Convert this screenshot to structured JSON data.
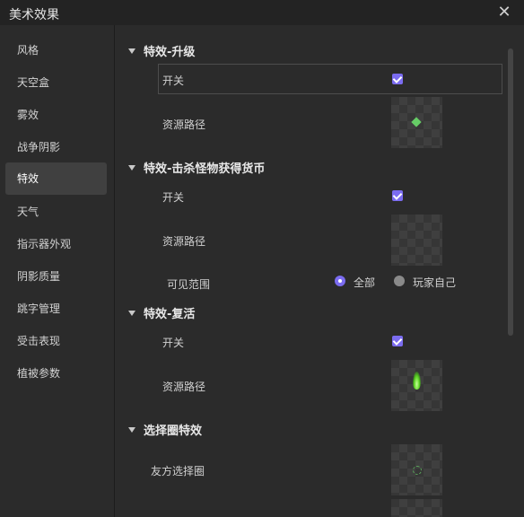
{
  "window": {
    "title": "美术效果",
    "close_icon": "close-icon"
  },
  "sidebar": {
    "items": [
      {
        "label": "风格"
      },
      {
        "label": "天空盒"
      },
      {
        "label": "雾效"
      },
      {
        "label": "战争阴影"
      },
      {
        "label": "特效",
        "active": true
      },
      {
        "label": "天气"
      },
      {
        "label": "指示器外观"
      },
      {
        "label": "阴影质量"
      },
      {
        "label": "跳字管理"
      },
      {
        "label": "受击表现"
      },
      {
        "label": "植被参数"
      }
    ]
  },
  "sections": [
    {
      "title": "特效-升级",
      "rows": {
        "switch_label": "开关",
        "switch_checked": true,
        "resource_label": "资源路径",
        "thumbnail_icon": "green-diamond"
      }
    },
    {
      "title": "特效-击杀怪物获得货币",
      "rows": {
        "switch_label": "开关",
        "switch_checked": true,
        "resource_label": "资源路径",
        "thumbnail_icon": "empty"
      },
      "visibility": {
        "label": "可见范围",
        "options": [
          {
            "label": "全部",
            "selected": true
          },
          {
            "label": "玩家自己",
            "selected": false
          }
        ]
      }
    },
    {
      "title": "特效-复活",
      "rows": {
        "switch_label": "开关",
        "switch_checked": true,
        "resource_label": "资源路径",
        "thumbnail_icon": "green-flame"
      }
    },
    {
      "title": "选择圈特效",
      "rows": {
        "friendly_label": "友方选择圈",
        "thumbnail_icon": "green-ring"
      }
    }
  ],
  "colors": {
    "accent": "#7b6cf0",
    "background": "#2b2b2b",
    "titlebar": "#232323",
    "sidebar_active": "#404040"
  }
}
